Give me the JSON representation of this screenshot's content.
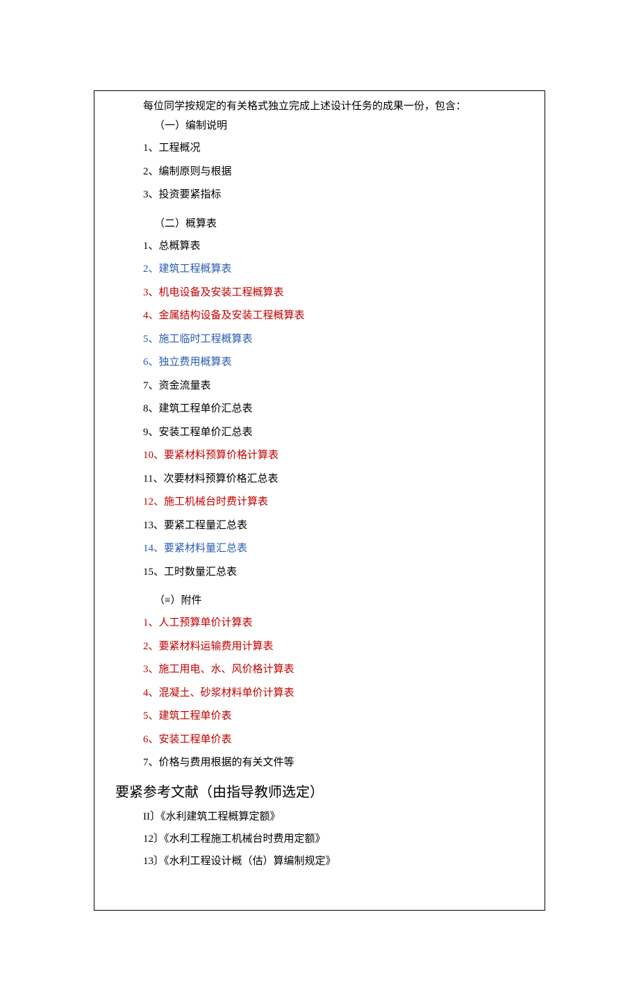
{
  "intro": "每位同学按规定的有关格式独立完成上述设计任务的成果一份，包含：",
  "section1": {
    "head": "（一）编制说明",
    "items": [
      {
        "text": "1、工程概况",
        "color": "black"
      },
      {
        "text": "2、编制原则与根据",
        "color": "black"
      },
      {
        "text": "3、投资要紧指标",
        "color": "black"
      }
    ]
  },
  "section2": {
    "head": "（二）概算表",
    "items": [
      {
        "text": "1、总概算表",
        "color": "black"
      },
      {
        "text": "2、建筑工程概算表",
        "color": "blue"
      },
      {
        "text": "3、机电设备及安装工程概算表",
        "color": "red"
      },
      {
        "text": "4、金属结构设备及安装工程概算表",
        "color": "red"
      },
      {
        "text": "5、施工临时工程概算表",
        "color": "blue"
      },
      {
        "text": "6、独立费用概算表",
        "color": "blue"
      },
      {
        "text": "7、资金流量表",
        "color": "black"
      },
      {
        "text": "8、建筑工程单价汇总表",
        "color": "black"
      },
      {
        "text": "9、安装工程单价汇总表",
        "color": "black"
      },
      {
        "text": "10、要紧材料预算价格计算表",
        "color": "red"
      },
      {
        "text": "11、次要材料预算价格汇总表",
        "color": "black"
      },
      {
        "text": "12、施工机械台时费计算表",
        "color": "red"
      },
      {
        "text": "13、要紧工程量汇总表",
        "color": "black"
      },
      {
        "text": "14、要紧材料量汇总表",
        "color": "blue"
      },
      {
        "text": "15、工时数量汇总表",
        "color": "black"
      }
    ]
  },
  "section3": {
    "head": "（≡）附件",
    "items": [
      {
        "text": "1、人工预算单价计算表",
        "color": "red"
      },
      {
        "text": "2、要紧材料运输费用计算表",
        "color": "red"
      },
      {
        "text": "3、施工用电、水、风价格计算表",
        "color": "red"
      },
      {
        "text": "4、混凝土、砂浆材料单价计算表",
        "color": "red"
      },
      {
        "text": "5、建筑工程单价表",
        "color": "red"
      },
      {
        "text": "6、安装工程单价表",
        "color": "red"
      },
      {
        "text": "7、价格与费用根据的有关文件等",
        "color": "black"
      }
    ]
  },
  "references": {
    "head": "要紧参考文献（由指导教师选定）",
    "items": [
      {
        "text": "II〕《水利建筑工程概算定额》"
      },
      {
        "text": "12〕《水利工程施工机械台时费用定额》"
      },
      {
        "text": "13〕《水利工程设计概（估）算编制规定》"
      }
    ]
  }
}
